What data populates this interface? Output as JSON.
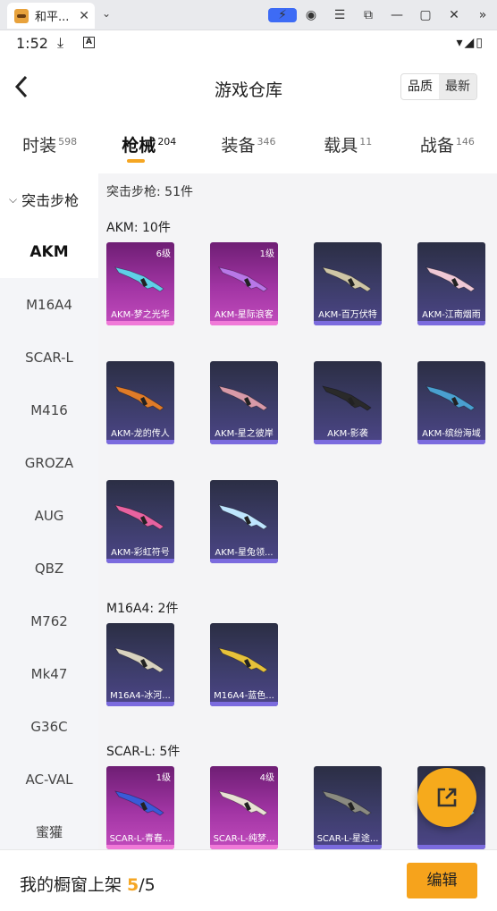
{
  "browser": {
    "tab_title": "和平..."
  },
  "statusbar": {
    "time": "1:52",
    "a_label": "A"
  },
  "header": {
    "title": "游戏仓库",
    "sort_quality": "品质",
    "sort_latest": "最新"
  },
  "categories": [
    {
      "label": "时装",
      "count": "598"
    },
    {
      "label": "枪械",
      "count": "204"
    },
    {
      "label": "装备",
      "count": "346"
    },
    {
      "label": "载具",
      "count": "11"
    },
    {
      "label": "战备",
      "count": "146"
    }
  ],
  "sidebar": {
    "group": "突击步枪",
    "items": [
      "AKM",
      "M16A4",
      "SCAR-L",
      "M416",
      "GROZA",
      "AUG",
      "QBZ",
      "M762",
      "Mk47",
      "G36C",
      "AC-VAL",
      "蜜獾"
    ]
  },
  "content": {
    "summary": "突击步枪: 51件",
    "sections": [
      {
        "title": "AKM: 10件",
        "items": [
          {
            "name": "AKM-梦之光华",
            "level": "6级",
            "quality": "pink"
          },
          {
            "name": "AKM-星际浪客",
            "level": "1级",
            "quality": "pink"
          },
          {
            "name": "AKM-百万伏特",
            "level": "",
            "quality": "purple"
          },
          {
            "name": "AKM-江南烟雨",
            "level": "",
            "quality": "purple"
          },
          {
            "name": "AKM-龙的传人",
            "level": "",
            "quality": "purple"
          },
          {
            "name": "AKM-星之彼岸",
            "level": "",
            "quality": "purple"
          },
          {
            "name": "AKM-影袭",
            "level": "",
            "quality": "purple"
          },
          {
            "name": "AKM-缤纷海域",
            "level": "",
            "quality": "purple"
          },
          {
            "name": "AKM-彩虹符号",
            "level": "",
            "quality": "purple"
          },
          {
            "name": "AKM-星兔领...",
            "level": "",
            "quality": "purple"
          }
        ]
      },
      {
        "title": "M16A4: 2件",
        "items": [
          {
            "name": "M16A4-冰河...",
            "level": "",
            "quality": "purple"
          },
          {
            "name": "M16A4-蓝色...",
            "level": "",
            "quality": "purple"
          }
        ]
      },
      {
        "title": "SCAR-L: 5件",
        "items": [
          {
            "name": "SCAR-L-青春...",
            "level": "1级",
            "quality": "pink"
          },
          {
            "name": "SCAR-L-纯梦...",
            "level": "4级",
            "quality": "pink"
          },
          {
            "name": "SCAR-L-星途...",
            "level": "",
            "quality": "purple"
          },
          {
            "name": "",
            "level": "",
            "quality": "purple"
          }
        ]
      }
    ]
  },
  "bottom": {
    "label": "我的橱窗上架 ",
    "count": "5",
    "sep_total": "/5",
    "edit_label": "编辑"
  },
  "icons": {
    "back": "chevron-left-icon",
    "share": "external-link-icon",
    "accent": "#f6aa1c"
  }
}
